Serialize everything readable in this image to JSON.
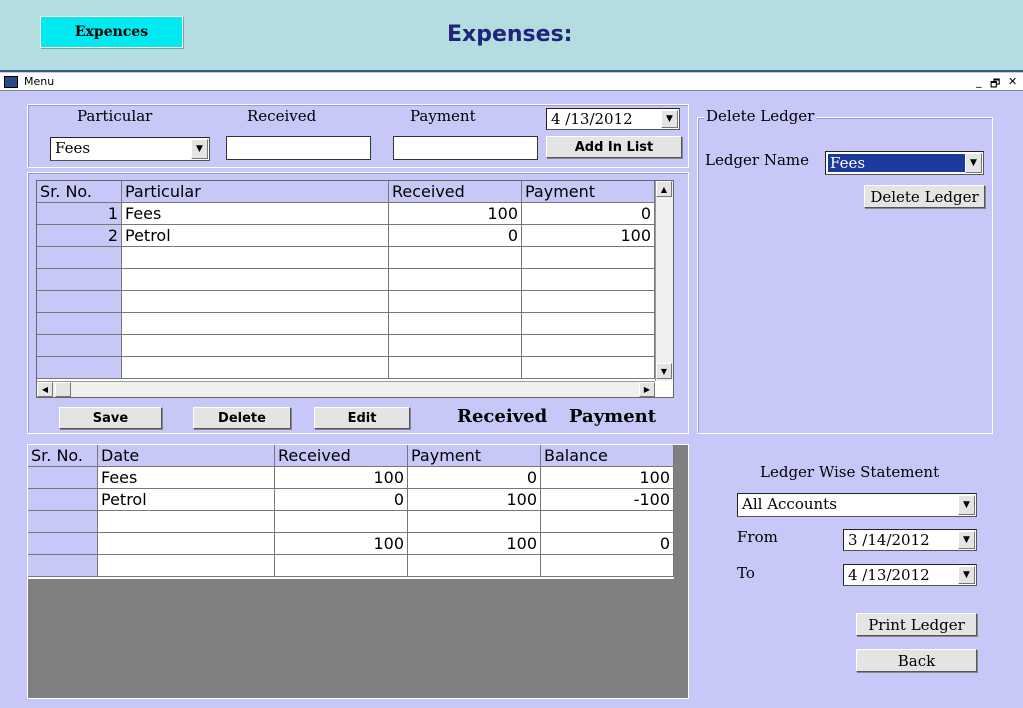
{
  "header": {
    "expences_button": "Expences",
    "title": "Expenses:"
  },
  "menubar": {
    "label": "Menu",
    "minimize": "_",
    "restore": "🗗",
    "close": "✕"
  },
  "entry": {
    "particular_label": "Particular",
    "received_label": "Received",
    "payment_label": "Payment",
    "date_value": "4 /13/2012",
    "particular_value": "Fees",
    "received_value": "",
    "payment_value": "",
    "add_button": "Add In List"
  },
  "top_grid": {
    "headers": [
      "Sr. No.",
      "Particular",
      "Received",
      "Payment"
    ],
    "rows": [
      {
        "sr": "1",
        "particular": "Fees",
        "received": "100",
        "payment": "0"
      },
      {
        "sr": "2",
        "particular": "Petrol",
        "received": "0",
        "payment": "100"
      }
    ]
  },
  "actions": {
    "save": "Save",
    "delete": "Delete",
    "edit": "Edit",
    "received_total_label": "Received",
    "payment_total_label": "Payment"
  },
  "bottom_grid": {
    "headers": [
      "Sr. No.",
      "Date",
      "Received",
      "Payment",
      "Balance"
    ],
    "rows": [
      {
        "date": "Fees",
        "received": "100",
        "payment": "0",
        "balance": "100"
      },
      {
        "date": "Petrol",
        "received": "0",
        "payment": "100",
        "balance": "-100"
      },
      {
        "date": "",
        "received": "",
        "payment": "",
        "balance": ""
      },
      {
        "date": "",
        "received": "100",
        "payment": "100",
        "balance": "0"
      },
      {
        "date": "",
        "received": "",
        "payment": "",
        "balance": ""
      }
    ]
  },
  "delete_ledger": {
    "group_title": "Delete Ledger",
    "ledger_name_label": "Ledger Name",
    "ledger_name_value": "Fees",
    "delete_button": "Delete Ledger"
  },
  "statement": {
    "title": "Ledger Wise Statement",
    "account_value": "All Accounts",
    "from_label": "From",
    "from_value": "3 /14/2012",
    "to_label": "To",
    "to_value": "4 /13/2012",
    "print_button": "Print Ledger",
    "back_button": "Back"
  },
  "colors": {
    "background": "#c8c8f8",
    "header": "#b3dde0",
    "title": "#23237c",
    "accent_button": "#00e8f0",
    "grid_empty": "#808080"
  }
}
